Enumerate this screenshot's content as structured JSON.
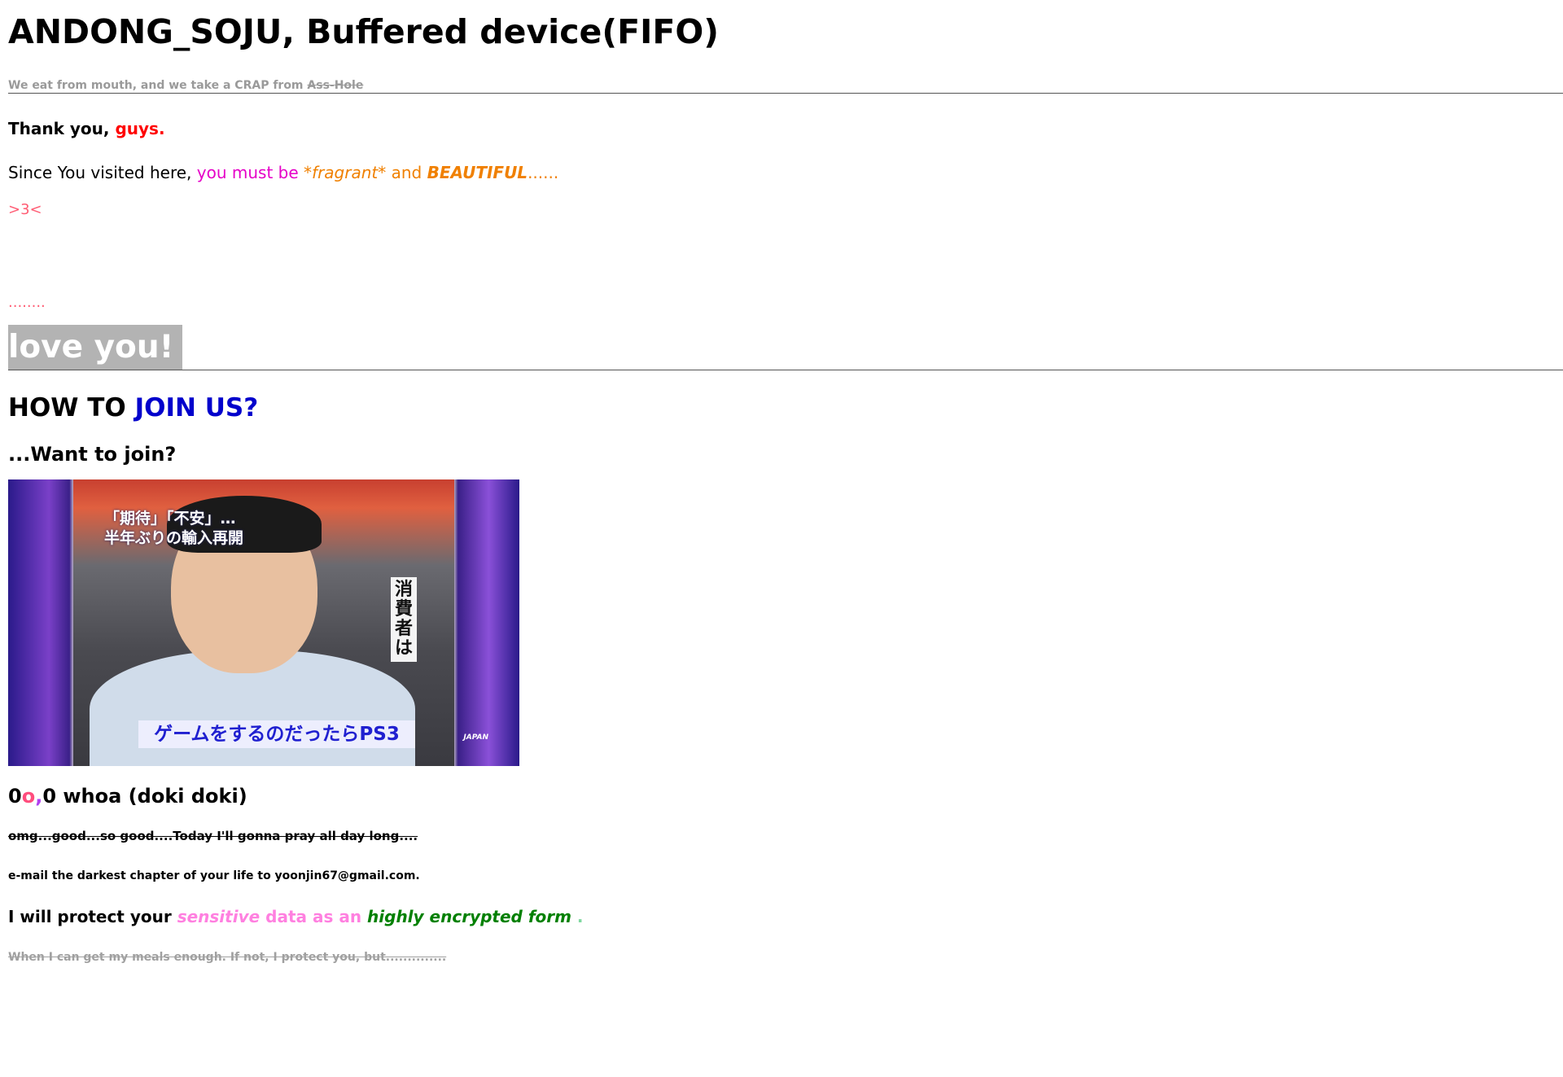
{
  "header": {
    "title": "ANDONG_SOJU, Buffered device(FIFO)",
    "tagline_prefix": "We eat from mouth, and we take a CRAP from ",
    "tagline_strike": "Ass-Hole"
  },
  "thanks": {
    "prefix": "Thank you, ",
    "highlight": "guys."
  },
  "since": {
    "prefix": "Since You visited here, ",
    "magenta": "you must be ",
    "star_open": "*",
    "fragrant": "fragrant",
    "star_close": "*",
    "and": " and ",
    "beautiful": "BEAUTIFUL",
    "ellipsis": "......"
  },
  "heart": ">3<",
  "dots": "........",
  "love": "love you!",
  "howto": {
    "prefix": "HOW TO ",
    "highlight": "JOIN US?"
  },
  "want_join": "...Want to join?",
  "photo": {
    "caption_top_line1": "「期待」「不安」…",
    "caption_top_line2": "半年ぶりの輸入再開",
    "caption_bottom": "ゲームをするのだったらPS3",
    "vertical_text": "消費者は",
    "logo": "JAPAN"
  },
  "whoa": {
    "zero1": "0",
    "o": "o",
    "comma": ",",
    "rest": "0 whoa (doki doki)"
  },
  "omg": "omg...good...so good....Today I'll gonna pray all day long....",
  "email": "e-mail the darkest chapter of your life to yoonjin67@gmail.com.",
  "protect": {
    "prefix": "I will protect your ",
    "sensitive": "sensitive",
    "middle": " data as an ",
    "encrypted": "highly encrypted form",
    "suffix": " ."
  },
  "meals": "When I can get my meals enough. If not, I protect you, but.............."
}
